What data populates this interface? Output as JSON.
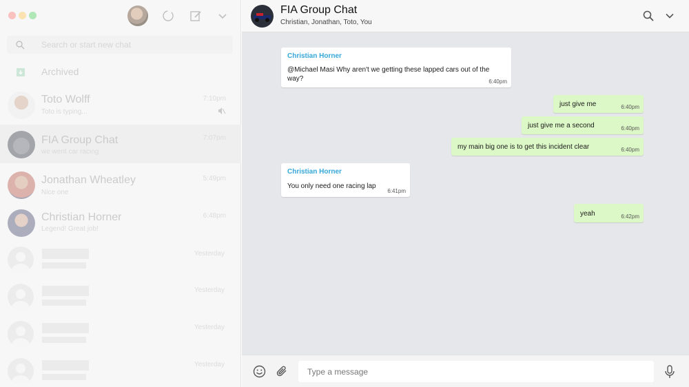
{
  "colors": {
    "accent_sender": "#35a7d8",
    "outgoing_bubble": "#dcf8c6",
    "incoming_bubble": "#ffffff",
    "chat_background": "#e5e7ea"
  },
  "sidebar": {
    "header_icons": [
      "status-icon",
      "compose-icon",
      "chevron-down-icon"
    ],
    "search": {
      "placeholder": "Search or start new chat"
    },
    "archived": {
      "label": "Archived"
    },
    "chats": [
      {
        "name": "Toto Wolff",
        "preview": "Toto is typing...",
        "time": "7:10pm",
        "muted": true
      },
      {
        "name": "FIA Group Chat",
        "preview": "we went car racing",
        "time": "7:07pm",
        "active": true
      },
      {
        "name": "Jonathan Wheatley",
        "preview": "Nice one",
        "time": "5:49pm"
      },
      {
        "name": "Christian Horner",
        "preview": "Legend! Great job!",
        "time": "6:48pm"
      }
    ],
    "placeholders": [
      {
        "time": "Yesterday"
      },
      {
        "time": "Yesterday"
      },
      {
        "time": "Yesterday"
      },
      {
        "time": "Yesterday"
      }
    ]
  },
  "conversation": {
    "title": "FIA Group Chat",
    "members": "Christian, Jonathan, Toto, You",
    "messages": [
      {
        "direction": "in",
        "sender": "Christian Horner",
        "text_lines": [
          "@Michael Masi Why aren't we getting these lapped cars out of the",
          "way?"
        ],
        "time": "6:40pm"
      },
      {
        "direction": "out",
        "text": "just give me",
        "time": "6:40pm"
      },
      {
        "direction": "out",
        "text": "just give me a second",
        "time": "6:40pm"
      },
      {
        "direction": "out",
        "text": "my main big one is to get this incident clear",
        "time": "6:40pm"
      },
      {
        "direction": "in",
        "sender": "Christian Horner",
        "text": "You only need one racing lap",
        "time": "6:41pm"
      },
      {
        "direction": "out",
        "text": "yeah",
        "time": "6:42pm"
      }
    ],
    "composer": {
      "placeholder": "Type a message",
      "icons": [
        "emoji-icon",
        "paperclip-icon",
        "microphone-icon"
      ]
    }
  }
}
